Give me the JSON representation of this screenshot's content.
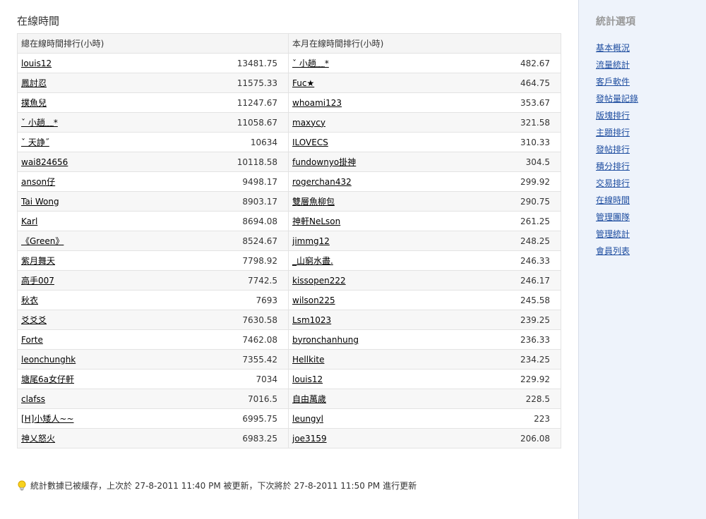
{
  "page_title": "在線時間",
  "table": {
    "col1_header": "總在線時間排行(小時)",
    "col2_header": "本月在線時間排行(小時)",
    "rows": [
      {
        "total_name": "louis12",
        "total_value": "13481.75",
        "month_name": "ˇ 小趟﹏*",
        "month_value": "482.67"
      },
      {
        "total_name": "鳳討忍",
        "total_value": "11575.33",
        "month_name": "Fuc★",
        "month_value": "464.75"
      },
      {
        "total_name": "撲魚兒",
        "total_value": "11247.67",
        "month_name": "whoami123",
        "month_value": "353.67"
      },
      {
        "total_name": "ˇ 小趟﹏*",
        "total_value": "11058.67",
        "month_name": "maxycy",
        "month_value": "321.58"
      },
      {
        "total_name": "ˇ 天諍˝",
        "total_value": "10634",
        "month_name": "ILOVECS",
        "month_value": "310.33"
      },
      {
        "total_name": "wai824656",
        "total_value": "10118.58",
        "month_name": "fundownyo掛神",
        "month_value": "304.5"
      },
      {
        "total_name": "anson仔",
        "total_value": "9498.17",
        "month_name": "rogerchan432",
        "month_value": "299.92"
      },
      {
        "total_name": "Tai Wong",
        "total_value": "8903.17",
        "month_name": "雙層魚柳包",
        "month_value": "290.75"
      },
      {
        "total_name": "Karl",
        "total_value": "8694.08",
        "month_name": "神軒NeLson",
        "month_value": "261.25"
      },
      {
        "total_name": "《Green》",
        "total_value": "8524.67",
        "month_name": "jimmg12",
        "month_value": "248.25"
      },
      {
        "total_name": "紫月舞天",
        "total_value": "7798.92",
        "month_name": "_山窮水盡.",
        "month_value": "246.33"
      },
      {
        "total_name": "高手007",
        "total_value": "7742.5",
        "month_name": "kissopen222",
        "month_value": "246.17"
      },
      {
        "total_name": "秋衣",
        "total_value": "7693",
        "month_name": "wilson225",
        "month_value": "245.58"
      },
      {
        "total_name": "爻爻爻",
        "total_value": "7630.58",
        "month_name": "Lsm1023",
        "month_value": "239.25"
      },
      {
        "total_name": "Forte",
        "total_value": "7462.08",
        "month_name": "byronchanhung",
        "month_value": "236.33"
      },
      {
        "total_name": "leonchunghk",
        "total_value": "7355.42",
        "month_name": "Hellkite",
        "month_value": "234.25"
      },
      {
        "total_name": "塘尾6a女仔軒",
        "total_value": "7034",
        "month_name": "louis12",
        "month_value": "229.92"
      },
      {
        "total_name": "clafss",
        "total_value": "7016.5",
        "month_name": "自由萬歲",
        "month_value": "228.5"
      },
      {
        "total_name": "[H]小矮人~~",
        "total_value": "6995.75",
        "month_name": "leungyl",
        "month_value": "223"
      },
      {
        "total_name": "神乂怒火",
        "total_value": "6983.25",
        "month_name": "joe3159",
        "month_value": "206.08"
      }
    ]
  },
  "footer_note": "統計數據已被緩存，上次於 27-8-2011 11:40 PM 被更新，下次將於 27-8-2011 11:50 PM 進行更新",
  "footer_icon": "lightbulb-icon",
  "sidebar": {
    "title": "統計選項",
    "items": [
      "基本概況",
      "流量統計",
      "客戶軟件",
      "發帖量記錄",
      "版塊排行",
      "主題排行",
      "發帖排行",
      "積分排行",
      "交易排行",
      "在線時間",
      "管理團隊",
      "管理統計",
      "會員列表"
    ]
  },
  "colors": {
    "sidebar_bg": "#eef3fb",
    "link_blue": "#1f4ea0",
    "row_alt": "#f7f7f7",
    "border": "#e3e3e3"
  }
}
